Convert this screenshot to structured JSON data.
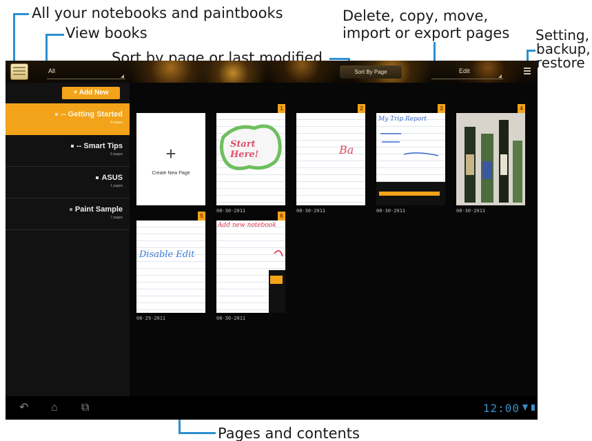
{
  "callouts": {
    "notebooks": "All your notebooks and paintbooks",
    "view_books": "View books",
    "sort": "Sort by page or last modified",
    "edit_line1": "Delete, copy, move,",
    "edit_line2": "import or export pages",
    "settings_line1": "Setting,",
    "settings_line2": "backup,",
    "settings_line3": "restore",
    "pages": "Pages and contents"
  },
  "actionbar": {
    "view_selector": "All",
    "sort_button": "Sort By Page",
    "edit_selector": "Edit",
    "icon_app": "notebook-app-icon",
    "icon_menu": "overflow-menu-icon"
  },
  "sidebar": {
    "add_new": "+ Add New",
    "items": [
      {
        "name": "-- Getting Started",
        "count": "8 pages",
        "active": true
      },
      {
        "name": "-- Smart Tips",
        "count": "6 pages",
        "active": false
      },
      {
        "name": "ASUS",
        "count": "1 pages",
        "active": false
      },
      {
        "name": "Paint Sample",
        "count": "7 pages",
        "active": false
      }
    ]
  },
  "grid": {
    "create_new": "Create New Page",
    "pages": [
      {
        "number": "1",
        "date": "08-30-2011",
        "content": "Start Here!"
      },
      {
        "number": "2",
        "date": "08-30-2011",
        "content": "Ba"
      },
      {
        "number": "3",
        "date": "08-30-2011",
        "content": "My Trip Report"
      },
      {
        "number": "4",
        "date": "08-30-2011",
        "content": ""
      },
      {
        "number": "5",
        "date": "08-29-2011",
        "content": "Disable Edit"
      },
      {
        "number": "6",
        "date": "08-30-2011",
        "content": "Add new notebook"
      }
    ]
  },
  "navbar": {
    "clock": "12:00",
    "icons": [
      "back-icon",
      "home-icon",
      "recent-apps-icon"
    ]
  },
  "colors": {
    "accent": "#f2a31a",
    "callout_line": "#2a8fd0",
    "clock": "#3a8fc8"
  }
}
